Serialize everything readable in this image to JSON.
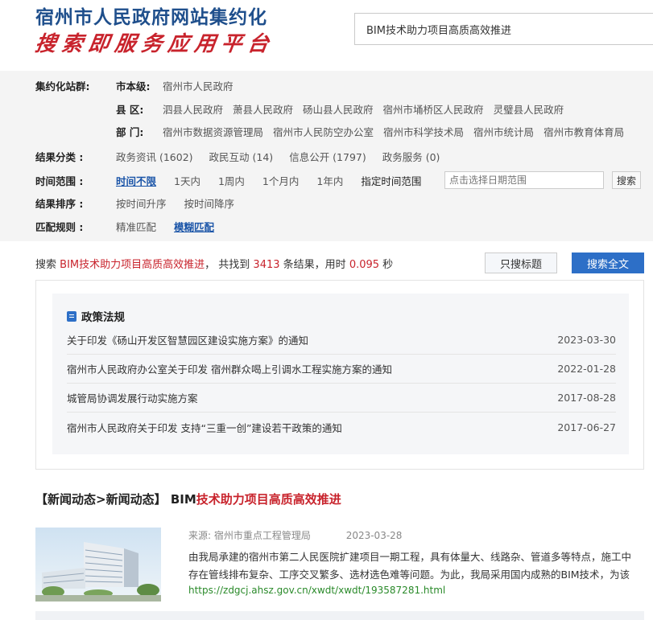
{
  "header": {
    "title": "宿州市人民政府网站集约化",
    "subtitle": "搜索即服务应用平台",
    "search_value": "BIM技术助力项目高质高效推进"
  },
  "filters": {
    "site_label": "集约化站群:",
    "city_label": "市本级:",
    "city_items": [
      "宿州市人民政府"
    ],
    "county_label": "县  区:",
    "county_items": [
      "泗县人民政府",
      "萧县人民政府",
      "砀山县人民政府",
      "宿州市埇桥区人民政府",
      "灵璧县人民政府"
    ],
    "dept_label": "部  门:",
    "dept_items": [
      "宿州市数据资源管理局",
      "宿州市人民防空办公室",
      "宿州市科学技术局",
      "宿州市统计局",
      "宿州市教育体育局"
    ],
    "category_label": "结果分类 :",
    "category_items": [
      "政务资讯 (1602)",
      "政民互动 (14)",
      "信息公开 (1797)",
      "政务服务 (0)"
    ],
    "time_label": "时间范围 :",
    "time_items": [
      "时间不限",
      "1天内",
      "1周内",
      "1个月内",
      "1年内",
      "指定时间范围"
    ],
    "date_placeholder": "点击选择日期范围",
    "date_search": "搜索",
    "sort_label": "结果排序 :",
    "sort_items": [
      "按时间升序",
      "按时间降序"
    ],
    "match_label": "匹配规则 :",
    "match_items": [
      "精准匹配",
      "模糊匹配"
    ]
  },
  "summary": {
    "prefix": "搜索",
    "query": "BIM技术助力项目高质高效推进",
    "mid": "， 共找到",
    "count": "3413",
    "unit": "条结果，用时",
    "time": "0.095",
    "sec": "秒",
    "btn_title": "只搜标题",
    "btn_full": "搜索全文"
  },
  "policy": {
    "heading": "政策法规",
    "items": [
      {
        "title": "关于印发《砀山开发区智慧园区建设实施方案》的通知",
        "date": "2023-03-30"
      },
      {
        "title": "宿州市人民政府办公室关于印发 宿州群众喝上引调水工程实施方案的通知",
        "date": "2022-01-28"
      },
      {
        "title": "城管局协调发展行动实施方案",
        "date": "2017-08-28"
      },
      {
        "title": "宿州市人民政府关于印发 支持“三重一创”建设若干政策的通知",
        "date": "2017-06-27"
      }
    ]
  },
  "news": {
    "category": "【新闻动态>新闻动态】",
    "title_prefix": "BIM",
    "title_hl": "技术助力项目高质高效推进",
    "source": "来源: 宿州市重点工程管理局",
    "date": "2023-03-28",
    "desc": "由我局承建的宿州市第二人民医院扩建项目一期工程，具有体量大、线路杂、管道多等特点，施工中存在管线排布复杂、工序交叉繁多、选材选色难等问题。为此，我局采用国内成熟的BIM技术，为该",
    "url": "https://zdgcj.ahsz.gov.cn/xwdt/xwdt/193587281.html"
  },
  "colors": {
    "brand_blue": "#1f4f8c",
    "accent_red": "#c8232c",
    "button_blue": "#2d6fc7"
  }
}
